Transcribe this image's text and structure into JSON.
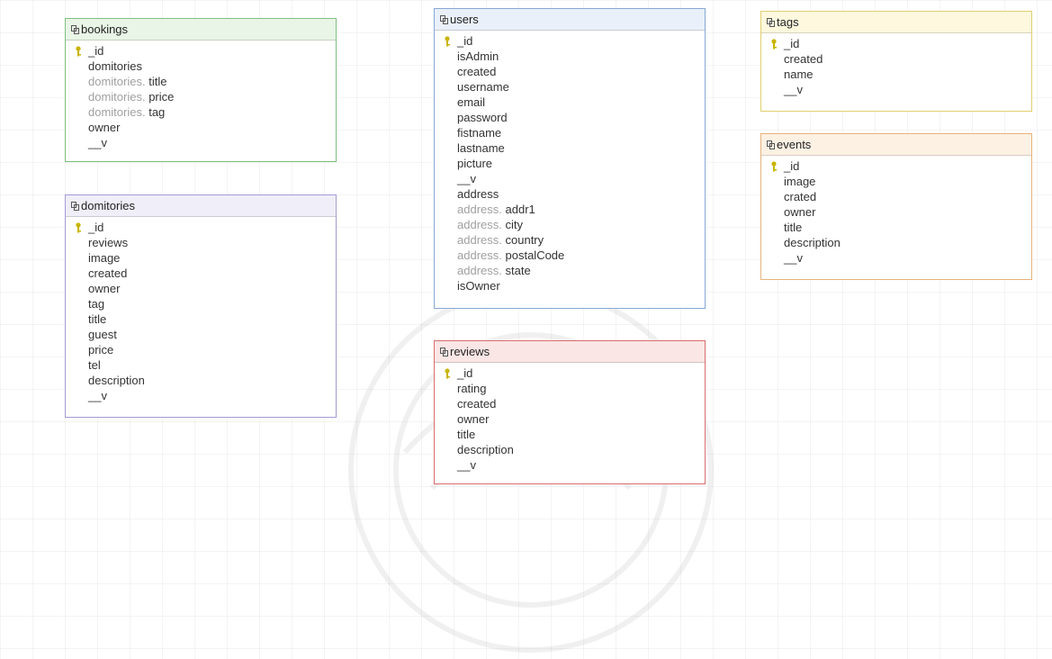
{
  "tables": {
    "bookings": {
      "name": "bookings",
      "fields": [
        {
          "prefix": "",
          "name": "_id",
          "pk": true
        },
        {
          "prefix": "",
          "name": "domitories"
        },
        {
          "prefix": "domitories.",
          "name": "title"
        },
        {
          "prefix": "domitories.",
          "name": "price"
        },
        {
          "prefix": "domitories.",
          "name": "tag"
        },
        {
          "prefix": "",
          "name": "owner"
        },
        {
          "prefix": "",
          "name": "__v"
        }
      ]
    },
    "domitories": {
      "name": "domitories",
      "fields": [
        {
          "prefix": "",
          "name": "_id",
          "pk": true
        },
        {
          "prefix": "",
          "name": "reviews"
        },
        {
          "prefix": "",
          "name": "image"
        },
        {
          "prefix": "",
          "name": "created"
        },
        {
          "prefix": "",
          "name": "owner"
        },
        {
          "prefix": "",
          "name": "tag"
        },
        {
          "prefix": "",
          "name": "title"
        },
        {
          "prefix": "",
          "name": "guest"
        },
        {
          "prefix": "",
          "name": "price"
        },
        {
          "prefix": "",
          "name": "tel"
        },
        {
          "prefix": "",
          "name": "description"
        },
        {
          "prefix": "",
          "name": "__v"
        }
      ]
    },
    "users": {
      "name": "users",
      "fields": [
        {
          "prefix": "",
          "name": "_id",
          "pk": true
        },
        {
          "prefix": "",
          "name": "isAdmin"
        },
        {
          "prefix": "",
          "name": "created"
        },
        {
          "prefix": "",
          "name": "username"
        },
        {
          "prefix": "",
          "name": "email"
        },
        {
          "prefix": "",
          "name": "password"
        },
        {
          "prefix": "",
          "name": "fistname"
        },
        {
          "prefix": "",
          "name": "lastname"
        },
        {
          "prefix": "",
          "name": "picture"
        },
        {
          "prefix": "",
          "name": "__v"
        },
        {
          "prefix": "",
          "name": "address"
        },
        {
          "prefix": "address.",
          "name": "addr1"
        },
        {
          "prefix": "address.",
          "name": "city"
        },
        {
          "prefix": "address.",
          "name": "country"
        },
        {
          "prefix": "address.",
          "name": "postalCode"
        },
        {
          "prefix": "address.",
          "name": "state"
        },
        {
          "prefix": "",
          "name": "isOwner"
        }
      ]
    },
    "reviews": {
      "name": "reviews",
      "fields": [
        {
          "prefix": "",
          "name": "_id",
          "pk": true
        },
        {
          "prefix": "",
          "name": "rating"
        },
        {
          "prefix": "",
          "name": "created"
        },
        {
          "prefix": "",
          "name": "owner"
        },
        {
          "prefix": "",
          "name": "title"
        },
        {
          "prefix": "",
          "name": "description"
        },
        {
          "prefix": "",
          "name": "__v"
        }
      ]
    },
    "tags": {
      "name": "tags",
      "fields": [
        {
          "prefix": "",
          "name": "_id",
          "pk": true
        },
        {
          "prefix": "",
          "name": "created"
        },
        {
          "prefix": "",
          "name": "name"
        },
        {
          "prefix": "",
          "name": "__v"
        }
      ]
    },
    "events": {
      "name": "events",
      "fields": [
        {
          "prefix": "",
          "name": "_id",
          "pk": true
        },
        {
          "prefix": "",
          "name": "image"
        },
        {
          "prefix": "",
          "name": "crated"
        },
        {
          "prefix": "",
          "name": "owner"
        },
        {
          "prefix": "",
          "name": "title"
        },
        {
          "prefix": "",
          "name": "description"
        },
        {
          "prefix": "",
          "name": "__v"
        }
      ]
    }
  },
  "icons": {
    "table": "table-icon",
    "primary_key": "key-icon"
  },
  "colors": {
    "bookings": "#7fbf7f",
    "domitories": "#a49bd4",
    "users": "#86a8d4",
    "reviews": "#d96d6d",
    "tags": "#e0cf6e",
    "events": "#e6b37a",
    "key": "#c9b400"
  }
}
